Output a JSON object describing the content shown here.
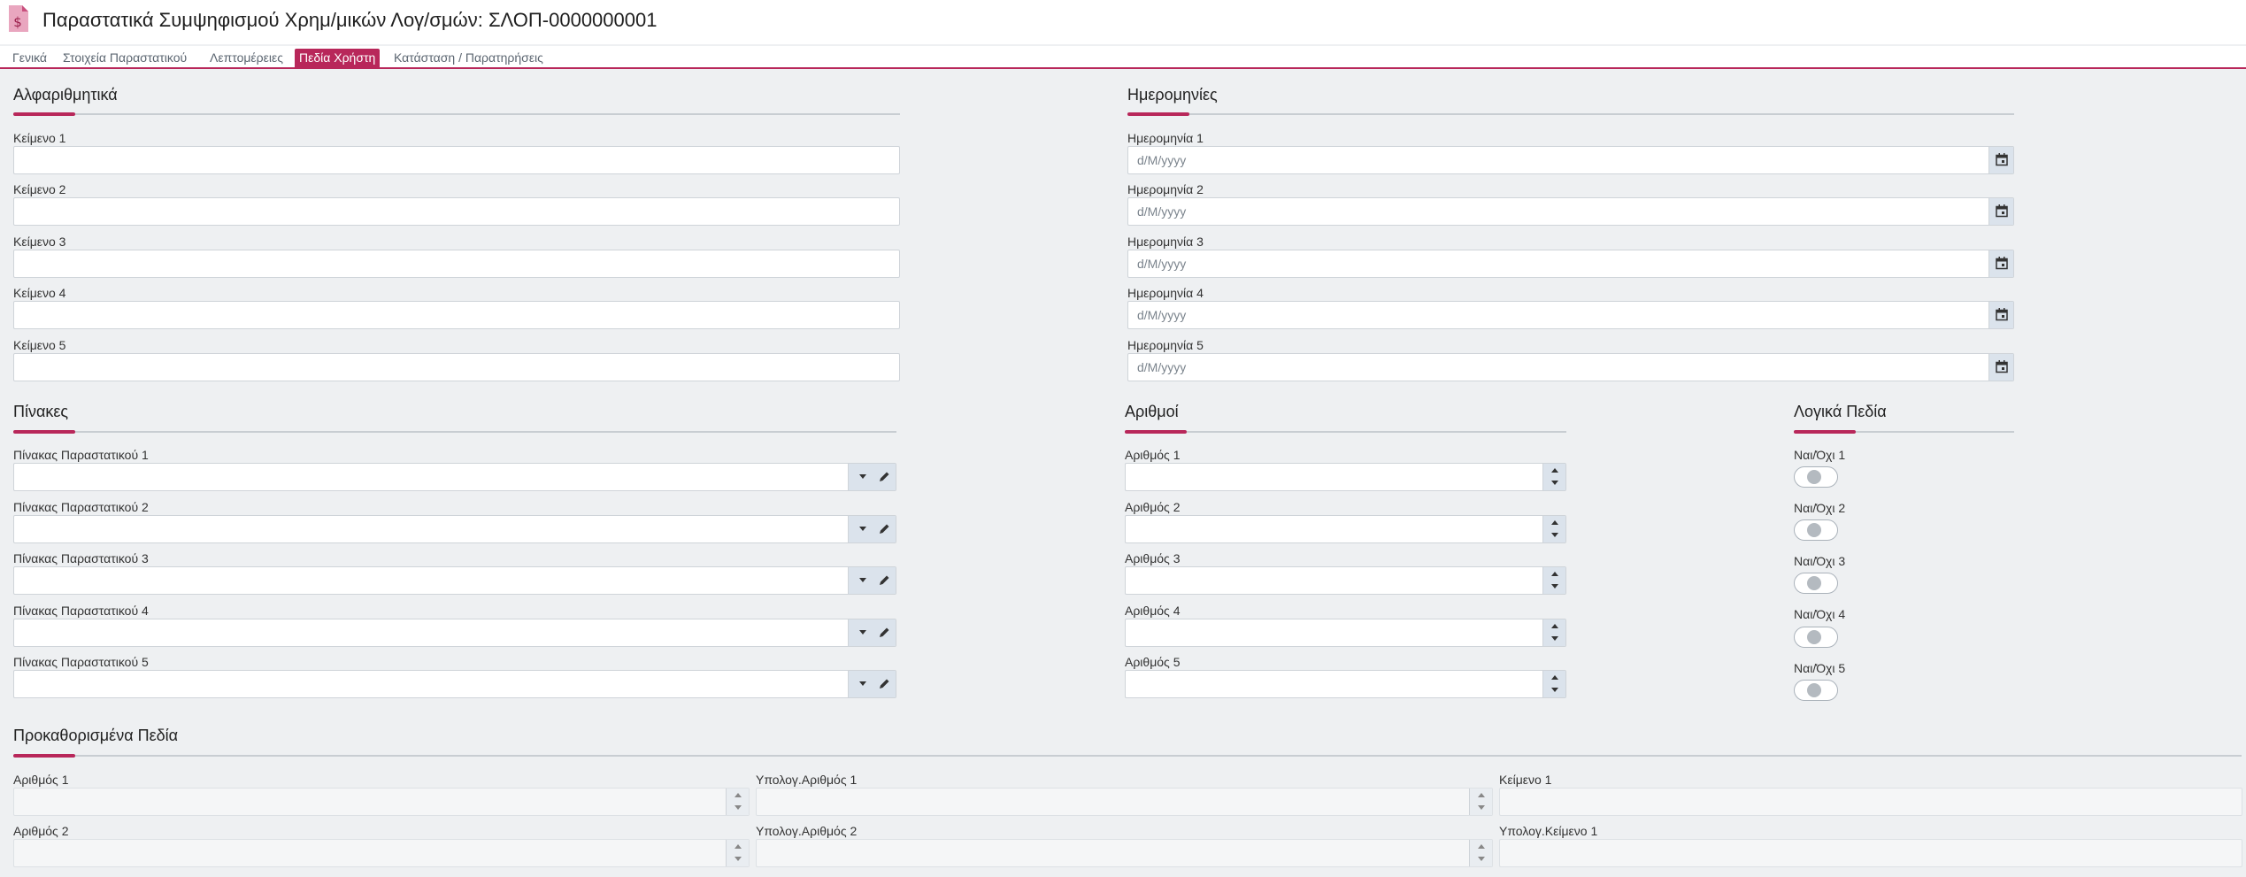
{
  "header": {
    "title": "Παραστατικά Συμψηφισμού Χρημ/μικών Λογ/σμών: ΣΛΟΠ-0000000001",
    "icon": "dollar-document-icon",
    "accent_color": "#b8275a"
  },
  "tabs": [
    {
      "label": "Γενικά",
      "active": false
    },
    {
      "label": "Στοιχεία Παραστατικού",
      "active": false
    },
    {
      "label": "Λεπτομέρειες",
      "active": false
    },
    {
      "label": "Πεδία Χρήστη",
      "active": true
    },
    {
      "label": "Κατάσταση / Παρατηρήσεις",
      "active": false
    }
  ],
  "alphanumeric": {
    "title": "Αλφαριθμητικά",
    "fields": [
      {
        "label": "Κείμενο 1",
        "value": ""
      },
      {
        "label": "Κείμενο 2",
        "value": ""
      },
      {
        "label": "Κείμενο 3",
        "value": ""
      },
      {
        "label": "Κείμενο 4",
        "value": ""
      },
      {
        "label": "Κείμενο 5",
        "value": ""
      }
    ]
  },
  "dates": {
    "title": "Ημερομηνίες",
    "fields": [
      {
        "label": "Ημερομηνία 1",
        "placeholder": "d/M/yyyy"
      },
      {
        "label": "Ημερομηνία 2",
        "placeholder": "d/M/yyyy"
      },
      {
        "label": "Ημερομηνία 3",
        "placeholder": "d/M/yyyy"
      },
      {
        "label": "Ημερομηνία 4",
        "placeholder": "d/M/yyyy"
      },
      {
        "label": "Ημερομηνία 5",
        "placeholder": "d/M/yyyy"
      }
    ]
  },
  "tables": {
    "title": "Πίνακες",
    "fields": [
      {
        "label": "Πίνακας Παραστατικού 1",
        "value": ""
      },
      {
        "label": "Πίνακας Παραστατικού 2",
        "value": ""
      },
      {
        "label": "Πίνακας Παραστατικού 3",
        "value": ""
      },
      {
        "label": "Πίνακας Παραστατικού 4",
        "value": ""
      },
      {
        "label": "Πίνακας Παραστατικού 5",
        "value": ""
      }
    ]
  },
  "numbers": {
    "title": "Αριθμοί",
    "fields": [
      {
        "label": "Αριθμός 1",
        "value": ""
      },
      {
        "label": "Αριθμός 2",
        "value": ""
      },
      {
        "label": "Αριθμός 3",
        "value": ""
      },
      {
        "label": "Αριθμός 4",
        "value": ""
      },
      {
        "label": "Αριθμός 5",
        "value": ""
      }
    ]
  },
  "booleans": {
    "title": "Λογικά Πεδία",
    "fields": [
      {
        "label": "Ναι/Όχι 1",
        "checked": false
      },
      {
        "label": "Ναι/Όχι 2",
        "checked": false
      },
      {
        "label": "Ναι/Όχι 3",
        "checked": false
      },
      {
        "label": "Ναι/Όχι 4",
        "checked": false
      },
      {
        "label": "Ναι/Όχι 5",
        "checked": false
      }
    ]
  },
  "predefined": {
    "title": "Προκαθορισμένα Πεδία",
    "rows": [
      [
        {
          "label": "Αριθμός 1",
          "type": "number"
        },
        {
          "label": "Υπολογ.Αριθμός 1",
          "type": "number"
        },
        {
          "label": "Κείμενο 1",
          "type": "text"
        }
      ],
      [
        {
          "label": "Αριθμός 2",
          "type": "number"
        },
        {
          "label": "Υπολογ.Αριθμός 2",
          "type": "number"
        },
        {
          "label": "Υπολογ.Κείμενο 1",
          "type": "text"
        }
      ]
    ]
  }
}
